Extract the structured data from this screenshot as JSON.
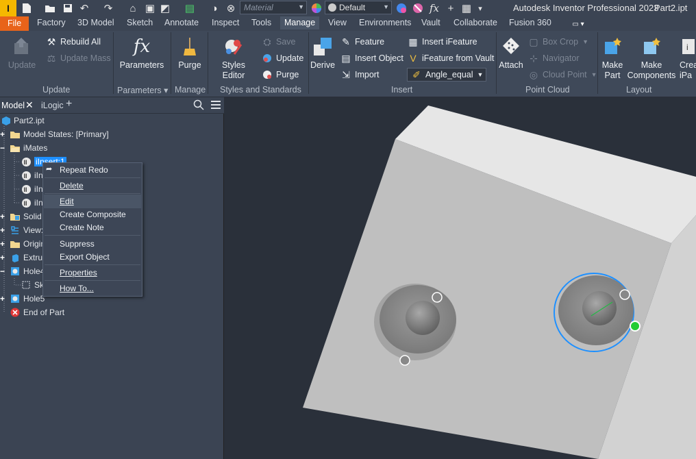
{
  "app": {
    "title": "Autodesk Inventor Professional 2023",
    "document": "Part2.ipt"
  },
  "qat": {
    "material_placeholder": "Material",
    "appearance_value": "Default"
  },
  "tabs": [
    {
      "label": "File"
    },
    {
      "label": "Factory"
    },
    {
      "label": "3D Model"
    },
    {
      "label": "Sketch"
    },
    {
      "label": "Annotate"
    },
    {
      "label": "Inspect"
    },
    {
      "label": "Tools"
    },
    {
      "label": "Manage"
    },
    {
      "label": "View"
    },
    {
      "label": "Environments"
    },
    {
      "label": "Vault"
    },
    {
      "label": "Collaborate"
    },
    {
      "label": "Fusion 360"
    }
  ],
  "ribbon": {
    "update": {
      "update": "Update",
      "rebuild_all": "Rebuild All",
      "update_mass": "Update Mass",
      "group": "Update"
    },
    "parameters": {
      "label": "Parameters",
      "group": "Parameters"
    },
    "manage": {
      "purge": "Purge",
      "group": "Manage"
    },
    "styles": {
      "styles_editor": "Styles Editor",
      "save": "Save",
      "update": "Update",
      "purge": "Purge",
      "group": "Styles and Standards"
    },
    "insert": {
      "derive": "Derive",
      "feature": "Feature",
      "insert_object": "Insert Object",
      "import": "Import",
      "insert_ifeature": "Insert iFeature",
      "ifeature_from_vault": "iFeature from Vault",
      "angle_equal": "Angle_equal",
      "group": "Insert"
    },
    "point_cloud": {
      "attach": "Attach",
      "box_crop": "Box Crop",
      "navigator": "Navigator",
      "cloud_point": "Cloud Point",
      "group": "Point Cloud"
    },
    "layout": {
      "make_part_1": "Make",
      "make_part_2": "Part",
      "make_components_1": "Make",
      "make_components_2": "Components",
      "create_1": "Crea",
      "create_2": "iPa",
      "group": "Layout"
    }
  },
  "browser": {
    "tabs": [
      "Model",
      "iLogic"
    ],
    "nodes": {
      "root": "Part2.ipt",
      "model_states": "Model States: [Primary]",
      "imates": "iMates",
      "insert1": "iInsert:1",
      "i2": "iIn",
      "i3": "iIn",
      "i4": "iIn",
      "solid": "Solid I",
      "view": "View:",
      "origin": "Origin",
      "extrus": "Extrus",
      "hole4": "Hole4",
      "sketch": "Sk",
      "hole5": "Hole5",
      "end": "End of Part"
    }
  },
  "context_menu": {
    "repeat_redo": "Repeat Redo",
    "delete": "Delete",
    "edit": "Edit",
    "create_composite": "Create Composite",
    "create_note": "Create Note",
    "suppress": "Suppress",
    "export_object": "Export Object",
    "properties": "Properties",
    "how_to": "How To..."
  },
  "colors": {
    "file_tab": "#e8631a",
    "selection": "#1e90ff",
    "accent_green": "#22cc33"
  }
}
